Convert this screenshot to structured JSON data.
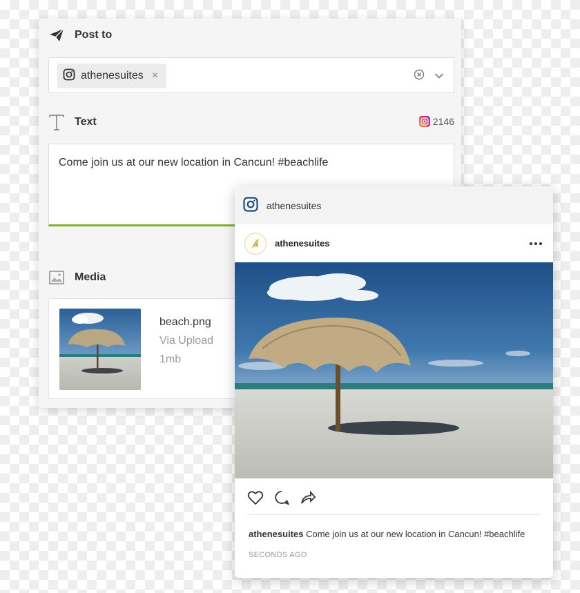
{
  "composer": {
    "post_to": {
      "title": "Post to",
      "icon": "paper-plane-icon",
      "selected_profile": "athenesuites",
      "remove_symbol": "×"
    },
    "text": {
      "title": "Text",
      "icon": "text-icon",
      "char_count": "2146",
      "value": "Come join us at our new location in Cancun! #beachlife"
    },
    "media": {
      "title": "Media",
      "icon": "image-icon",
      "file_name": "beach.png",
      "source": "Via Upload",
      "size": "1mb"
    }
  },
  "preview": {
    "network_account": "athenesuites",
    "post_user": "athenesuites",
    "caption_user": "athenesuites",
    "caption_text": " Come join us at our new location in Cancun! #beachlife",
    "timestamp": "SECONDS AGO"
  },
  "colors": {
    "accent_green": "#7ab32e",
    "panel_bg": "#f5f5f5",
    "instagram_blue": "#1f4d7a"
  }
}
